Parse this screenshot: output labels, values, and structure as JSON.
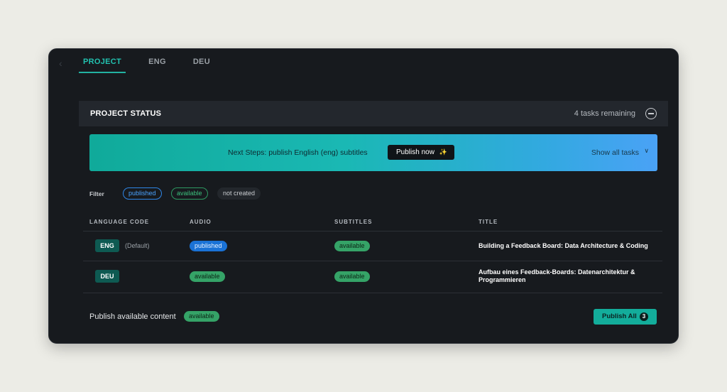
{
  "tabs": [
    {
      "label": "PROJECT"
    },
    {
      "label": "ENG"
    },
    {
      "label": "DEU"
    }
  ],
  "status": {
    "title": "PROJECT STATUS",
    "remaining": "4 tasks remaining"
  },
  "banner": {
    "text": "Next Steps: publish English (eng) subtitles",
    "publish_now": "Publish now",
    "show_all": "Show all tasks"
  },
  "filter": {
    "label": "Filter",
    "options": [
      "published",
      "available",
      "not created"
    ]
  },
  "table": {
    "headers": [
      "LANGUAGE CODE",
      "AUDIO",
      "SUBTITLES",
      "TITLE"
    ],
    "rows": [
      {
        "code": "ENG",
        "default": "(Default)",
        "audio": "published",
        "subtitles": "available",
        "title": "Building a Feedback Board: Data Architecture & Coding"
      },
      {
        "code": "DEU",
        "default": "",
        "audio": "available",
        "subtitles": "available",
        "title": "Aufbau eines Feedback-Boards: Datenarchitektur & Programmieren"
      }
    ]
  },
  "footer": {
    "text": "Publish available content",
    "status": "available",
    "publish_all": "Publish All",
    "count": "3"
  },
  "colors": {
    "accent": "#22c2b0",
    "published": "#1a72d6",
    "available": "#35a367",
    "frame_bg": "#171a1e"
  }
}
